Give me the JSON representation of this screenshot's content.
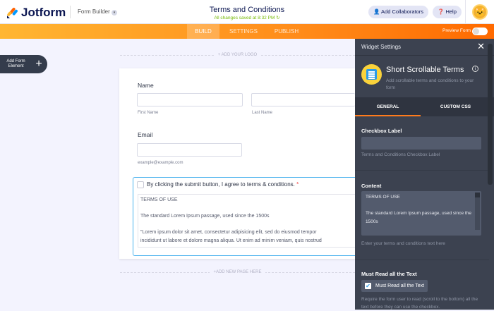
{
  "header": {
    "brand": "Jotform",
    "builder_menu": "Form Builder",
    "form_title": "Terms and Conditions",
    "saved_status": "All changes saved at 8:32 PM",
    "add_collaborators": "Add Collaborators",
    "help": "Help"
  },
  "nav": {
    "tabs": [
      "BUILD",
      "SETTINGS",
      "PUBLISH"
    ],
    "active": "BUILD",
    "preview_label": "Preview Form",
    "preview_on": false
  },
  "colors": {
    "orange": "#ff8c1a",
    "panel": "#3c4250",
    "accent_blue": "#4ab2ee"
  },
  "sidebar": {
    "add_element": "Add Form Element"
  },
  "canvas": {
    "add_logo": "+ ADD YOUR LOGO",
    "add_page": "+ADD NEW PAGE HERE"
  },
  "form": {
    "name_label": "Name",
    "first_name": "First Name",
    "last_name": "Last Name",
    "email_label": "Email",
    "email_hint": "example@example.com",
    "terms_checkbox": "By clicking the submit button, I agree to terms & conditions.",
    "required_mark": "*",
    "terms_lines": [
      "TERMS OF USE",
      "",
      "The standard Lorem Ipsum passage, used since the 1500s",
      "",
      "\"Lorem ipsum dolor sit amet, consectetur adipisicing elit, sed do eiusmod tempor",
      "incididunt ut labore et dolore magna aliqua. Ut enim ad minim veniam, quis nostrud"
    ]
  },
  "panel": {
    "title": "Widget Settings",
    "widget_name": "Short Scrollable Terms",
    "widget_desc": "Add scrollable terms and conditions to your form",
    "tabs": [
      "GENERAL",
      "CUSTOM CSS"
    ],
    "checkbox_label": {
      "label": "Checkbox Label",
      "value": "",
      "hint": "Terms and Conditions Checkbox Label"
    },
    "content": {
      "label": "Content",
      "lines": [
        "TERMS OF USE",
        "",
        "The standard Lorem Ipsum passage, used since the 1500s"
      ],
      "hint": "Enter your terms and conditions text here"
    },
    "must_read": {
      "label": "Must Read all the Text",
      "option": "Must Read all the Text",
      "checked": true,
      "hint": "Require the form user to read (scroll to the bottom) all the text before they can use the checkbox."
    }
  }
}
